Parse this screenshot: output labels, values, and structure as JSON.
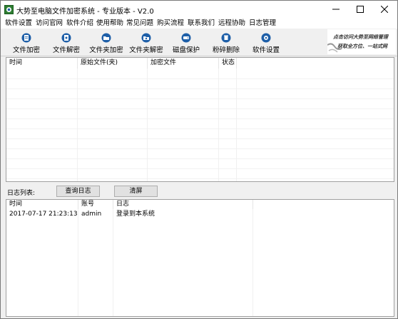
{
  "window": {
    "title": "大势至电脑文件加密系统 - 专业版本 - V2.0"
  },
  "menu": [
    {
      "label": "软件设置"
    },
    {
      "label": "访问官网"
    },
    {
      "label": "软件介绍"
    },
    {
      "label": "使用帮助"
    },
    {
      "label": "常见问题"
    },
    {
      "label": "购买流程"
    },
    {
      "label": "联系我们"
    },
    {
      "label": "远程协助"
    },
    {
      "label": "日志管理"
    }
  ],
  "toolbar": [
    {
      "label": "文件加密",
      "icon": "file-encrypt-icon"
    },
    {
      "label": "文件解密",
      "icon": "file-decrypt-icon"
    },
    {
      "label": "文件夹加密",
      "icon": "folder-encrypt-icon"
    },
    {
      "label": "文件夹解密",
      "icon": "folder-decrypt-icon"
    },
    {
      "label": "磁盘保护",
      "icon": "disk-protect-icon"
    },
    {
      "label": "粉碎删除",
      "icon": "shred-delete-icon"
    },
    {
      "label": "软件设置",
      "icon": "settings-icon"
    }
  ],
  "banner": {
    "line1": "点击访问大势至网络管理",
    "line2": "获取全方位、一站式网"
  },
  "file_table": {
    "columns": [
      "时间",
      "原始文件(夹)",
      "加密文件",
      "状态"
    ]
  },
  "log": {
    "label": "日志列表:",
    "query_button": "查询日志",
    "clear_button": "清屏",
    "columns": [
      "时间",
      "账号",
      "日志"
    ],
    "rows": [
      {
        "time": "2017-07-17 21:23:13",
        "account": "admin",
        "message": "登录到本系统"
      }
    ]
  },
  "colors": {
    "icon_blue": "#1e5fa8",
    "window_bg": "#f0f0f0"
  }
}
